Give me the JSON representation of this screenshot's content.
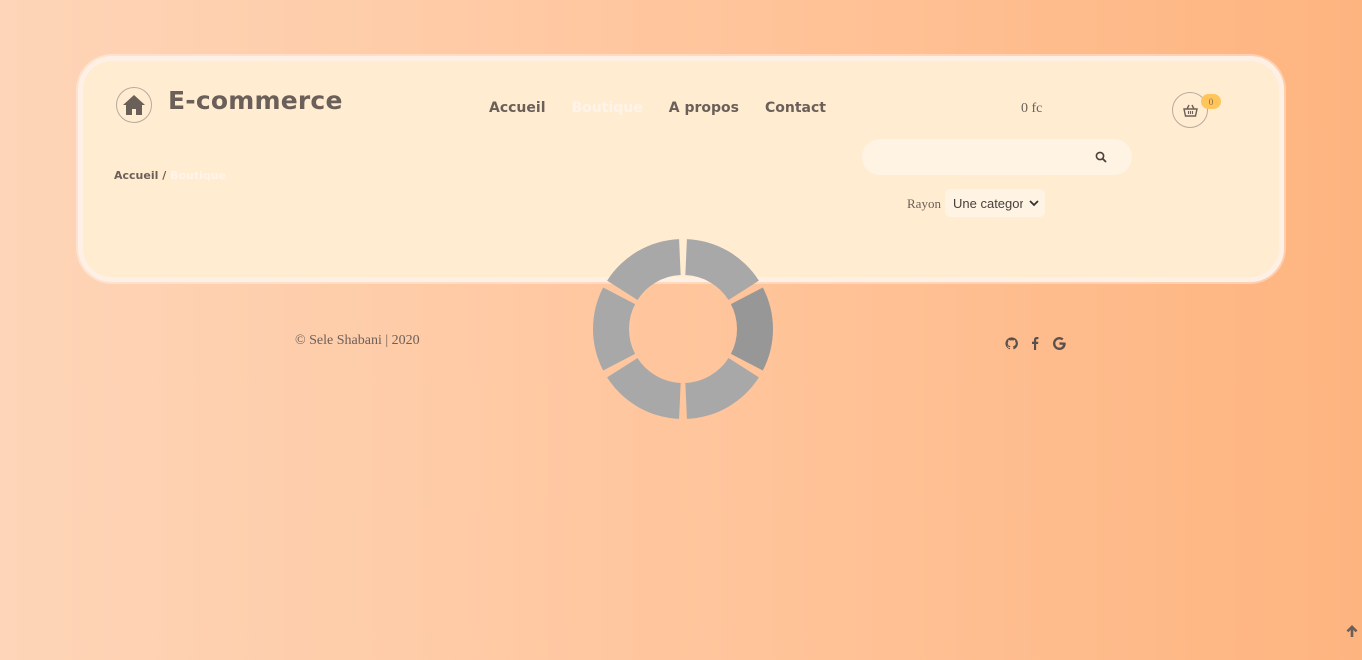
{
  "header": {
    "brand": "E-commerce",
    "logo_icon": "home-icon",
    "nav": [
      {
        "label": "Accueil"
      },
      {
        "label": "Boutique"
      },
      {
        "label": "A propos"
      },
      {
        "label": "Contact"
      }
    ],
    "cart_total": "0 fc",
    "cart_count": "0",
    "cart_icon": "basket-icon"
  },
  "search": {
    "value": "",
    "placeholder": "",
    "icon": "search-icon"
  },
  "filter": {
    "label": "Rayon",
    "selected": "Une categorie"
  },
  "breadcrumb": {
    "parent": "Accueil",
    "separator": "/",
    "current": "Boutique"
  },
  "footer": {
    "copyright": "© Sele Shabani | 2020",
    "social_icons": [
      "github-icon",
      "facebook-icon",
      "google-icon"
    ]
  },
  "colors": {
    "card_bg": "#ffecd1",
    "active_nav": "#fff4ea",
    "badge": "#ffc55a",
    "spinner": "#a8a8a8"
  }
}
